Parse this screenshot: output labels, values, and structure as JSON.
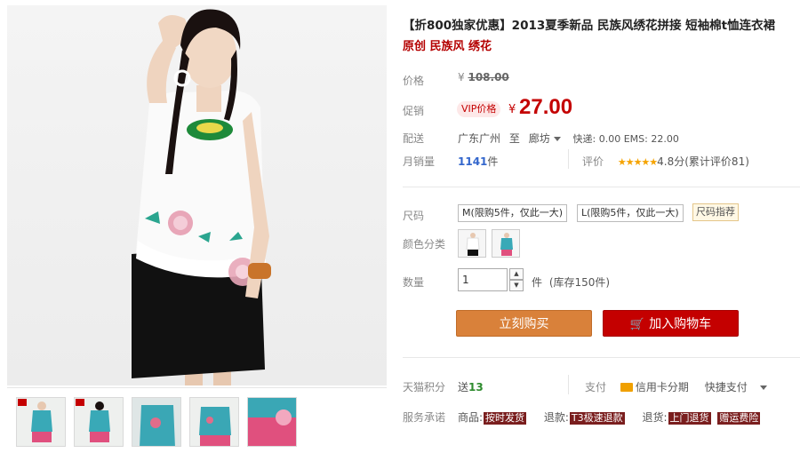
{
  "product": {
    "title": "【折800独家优惠】2013夏季新品 民族风绣花拼接 短袖棉t恤连衣裙",
    "subtitle": "原创 民族风 绣花"
  },
  "price": {
    "label": "价格",
    "currency": "¥",
    "original": "108.00"
  },
  "promo": {
    "label": "促销",
    "badge": "VIP价格",
    "currency": "¥",
    "current": "27.00"
  },
  "shipping": {
    "label": "配送",
    "from": "广东广州",
    "to_label": "至",
    "to": "廊坊",
    "fees": "快递: 0.00 EMS: 22.00"
  },
  "sales": {
    "label": "月销量",
    "count": "1141",
    "unit": "件",
    "rating_label": "评价",
    "stars": "★★★★★",
    "score": "4.8分",
    "reviews": "(累计评价81)"
  },
  "size": {
    "label": "尺码",
    "options": [
      "M(限购5件，仅此一大)",
      "L(限购5件，仅此一大)"
    ],
    "guide": "尺码指荐"
  },
  "color": {
    "label": "颜色分类",
    "swatches": [
      "white-dress",
      "blue-dress"
    ]
  },
  "quantity": {
    "label": "数量",
    "value": "1",
    "unit": "件",
    "stock": "(库存150件)"
  },
  "actions": {
    "buy_now": "立刻购买",
    "add_cart": "加入购物车"
  },
  "points": {
    "label": "天猫积分",
    "value_prefix": "送",
    "value": "13",
    "pay_label": "支付",
    "credit_label": "信用卡分期",
    "quick_pay": "快捷支付"
  },
  "service": {
    "label": "服务承诺",
    "goods_label": "商品:",
    "goods_tag": "按时发货",
    "refund_label": "退款:",
    "refund_tag": "T3极速退款",
    "return_label": "退货:",
    "return_tag": "上门退货",
    "extra_tag": "赠运费险"
  },
  "colors": {
    "accent_red": "#c40000",
    "buy_orange": "#d9813a",
    "star_gold": "#f5a300"
  }
}
